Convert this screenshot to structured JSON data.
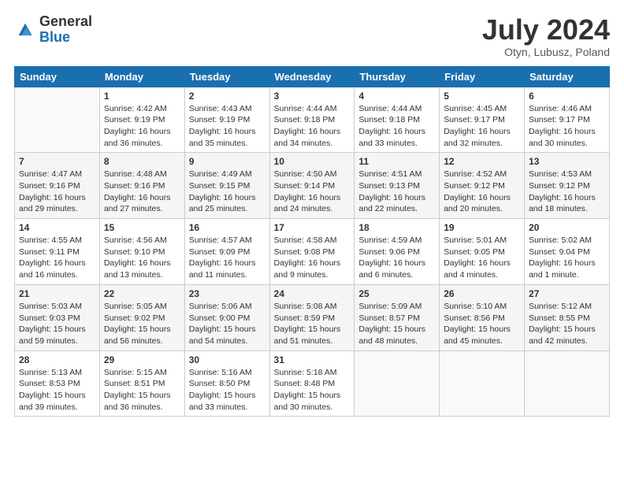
{
  "header": {
    "logo_general": "General",
    "logo_blue": "Blue",
    "month": "July 2024",
    "location": "Otyn, Lubusz, Poland"
  },
  "weekdays": [
    "Sunday",
    "Monday",
    "Tuesday",
    "Wednesday",
    "Thursday",
    "Friday",
    "Saturday"
  ],
  "weeks": [
    [
      {
        "day": "",
        "sunrise": "",
        "sunset": "",
        "daylight": ""
      },
      {
        "day": "1",
        "sunrise": "Sunrise: 4:42 AM",
        "sunset": "Sunset: 9:19 PM",
        "daylight": "Daylight: 16 hours and 36 minutes."
      },
      {
        "day": "2",
        "sunrise": "Sunrise: 4:43 AM",
        "sunset": "Sunset: 9:19 PM",
        "daylight": "Daylight: 16 hours and 35 minutes."
      },
      {
        "day": "3",
        "sunrise": "Sunrise: 4:44 AM",
        "sunset": "Sunset: 9:18 PM",
        "daylight": "Daylight: 16 hours and 34 minutes."
      },
      {
        "day": "4",
        "sunrise": "Sunrise: 4:44 AM",
        "sunset": "Sunset: 9:18 PM",
        "daylight": "Daylight: 16 hours and 33 minutes."
      },
      {
        "day": "5",
        "sunrise": "Sunrise: 4:45 AM",
        "sunset": "Sunset: 9:17 PM",
        "daylight": "Daylight: 16 hours and 32 minutes."
      },
      {
        "day": "6",
        "sunrise": "Sunrise: 4:46 AM",
        "sunset": "Sunset: 9:17 PM",
        "daylight": "Daylight: 16 hours and 30 minutes."
      }
    ],
    [
      {
        "day": "7",
        "sunrise": "Sunrise: 4:47 AM",
        "sunset": "Sunset: 9:16 PM",
        "daylight": "Daylight: 16 hours and 29 minutes."
      },
      {
        "day": "8",
        "sunrise": "Sunrise: 4:48 AM",
        "sunset": "Sunset: 9:16 PM",
        "daylight": "Daylight: 16 hours and 27 minutes."
      },
      {
        "day": "9",
        "sunrise": "Sunrise: 4:49 AM",
        "sunset": "Sunset: 9:15 PM",
        "daylight": "Daylight: 16 hours and 25 minutes."
      },
      {
        "day": "10",
        "sunrise": "Sunrise: 4:50 AM",
        "sunset": "Sunset: 9:14 PM",
        "daylight": "Daylight: 16 hours and 24 minutes."
      },
      {
        "day": "11",
        "sunrise": "Sunrise: 4:51 AM",
        "sunset": "Sunset: 9:13 PM",
        "daylight": "Daylight: 16 hours and 22 minutes."
      },
      {
        "day": "12",
        "sunrise": "Sunrise: 4:52 AM",
        "sunset": "Sunset: 9:12 PM",
        "daylight": "Daylight: 16 hours and 20 minutes."
      },
      {
        "day": "13",
        "sunrise": "Sunrise: 4:53 AM",
        "sunset": "Sunset: 9:12 PM",
        "daylight": "Daylight: 16 hours and 18 minutes."
      }
    ],
    [
      {
        "day": "14",
        "sunrise": "Sunrise: 4:55 AM",
        "sunset": "Sunset: 9:11 PM",
        "daylight": "Daylight: 16 hours and 16 minutes."
      },
      {
        "day": "15",
        "sunrise": "Sunrise: 4:56 AM",
        "sunset": "Sunset: 9:10 PM",
        "daylight": "Daylight: 16 hours and 13 minutes."
      },
      {
        "day": "16",
        "sunrise": "Sunrise: 4:57 AM",
        "sunset": "Sunset: 9:09 PM",
        "daylight": "Daylight: 16 hours and 11 minutes."
      },
      {
        "day": "17",
        "sunrise": "Sunrise: 4:58 AM",
        "sunset": "Sunset: 9:08 PM",
        "daylight": "Daylight: 16 hours and 9 minutes."
      },
      {
        "day": "18",
        "sunrise": "Sunrise: 4:59 AM",
        "sunset": "Sunset: 9:06 PM",
        "daylight": "Daylight: 16 hours and 6 minutes."
      },
      {
        "day": "19",
        "sunrise": "Sunrise: 5:01 AM",
        "sunset": "Sunset: 9:05 PM",
        "daylight": "Daylight: 16 hours and 4 minutes."
      },
      {
        "day": "20",
        "sunrise": "Sunrise: 5:02 AM",
        "sunset": "Sunset: 9:04 PM",
        "daylight": "Daylight: 16 hours and 1 minute."
      }
    ],
    [
      {
        "day": "21",
        "sunrise": "Sunrise: 5:03 AM",
        "sunset": "Sunset: 9:03 PM",
        "daylight": "Daylight: 15 hours and 59 minutes."
      },
      {
        "day": "22",
        "sunrise": "Sunrise: 5:05 AM",
        "sunset": "Sunset: 9:02 PM",
        "daylight": "Daylight: 15 hours and 56 minutes."
      },
      {
        "day": "23",
        "sunrise": "Sunrise: 5:06 AM",
        "sunset": "Sunset: 9:00 PM",
        "daylight": "Daylight: 15 hours and 54 minutes."
      },
      {
        "day": "24",
        "sunrise": "Sunrise: 5:08 AM",
        "sunset": "Sunset: 8:59 PM",
        "daylight": "Daylight: 15 hours and 51 minutes."
      },
      {
        "day": "25",
        "sunrise": "Sunrise: 5:09 AM",
        "sunset": "Sunset: 8:57 PM",
        "daylight": "Daylight: 15 hours and 48 minutes."
      },
      {
        "day": "26",
        "sunrise": "Sunrise: 5:10 AM",
        "sunset": "Sunset: 8:56 PM",
        "daylight": "Daylight: 15 hours and 45 minutes."
      },
      {
        "day": "27",
        "sunrise": "Sunrise: 5:12 AM",
        "sunset": "Sunset: 8:55 PM",
        "daylight": "Daylight: 15 hours and 42 minutes."
      }
    ],
    [
      {
        "day": "28",
        "sunrise": "Sunrise: 5:13 AM",
        "sunset": "Sunset: 8:53 PM",
        "daylight": "Daylight: 15 hours and 39 minutes."
      },
      {
        "day": "29",
        "sunrise": "Sunrise: 5:15 AM",
        "sunset": "Sunset: 8:51 PM",
        "daylight": "Daylight: 15 hours and 36 minutes."
      },
      {
        "day": "30",
        "sunrise": "Sunrise: 5:16 AM",
        "sunset": "Sunset: 8:50 PM",
        "daylight": "Daylight: 15 hours and 33 minutes."
      },
      {
        "day": "31",
        "sunrise": "Sunrise: 5:18 AM",
        "sunset": "Sunset: 8:48 PM",
        "daylight": "Daylight: 15 hours and 30 minutes."
      },
      {
        "day": "",
        "sunrise": "",
        "sunset": "",
        "daylight": ""
      },
      {
        "day": "",
        "sunrise": "",
        "sunset": "",
        "daylight": ""
      },
      {
        "day": "",
        "sunrise": "",
        "sunset": "",
        "daylight": ""
      }
    ]
  ]
}
